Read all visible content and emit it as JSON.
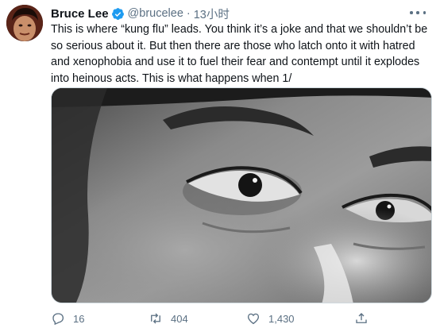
{
  "tweet": {
    "author_name": "Bruce Lee",
    "handle": "@brucelee",
    "separator": "·",
    "time": "13小时",
    "text": "This is where “kung flu” leads. You think it’s a joke and that we shouldn’t be so serious about it. But then there are those who latch onto it with hatred and xenophobia and use it to fuel their fear and contempt until it explodes into heinous acts. This is what happens when 1/"
  },
  "icons": {
    "verified": "verified-badge-icon",
    "more": "more-icon",
    "reply": "reply-icon",
    "retweet": "retweet-icon",
    "like": "like-icon",
    "share": "share-icon"
  },
  "actions": {
    "reply_count": "16",
    "retweet_count": "404",
    "like_count": "1,430"
  },
  "colors": {
    "verified_blue": "#1d9bf0",
    "secondary_text": "#5b7083",
    "border": "#cfd9de"
  }
}
